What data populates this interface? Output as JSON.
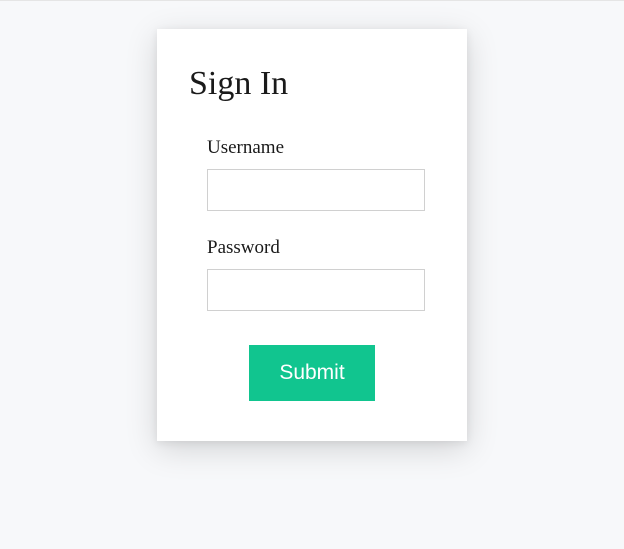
{
  "title": "Sign In",
  "form": {
    "username": {
      "label": "Username",
      "value": ""
    },
    "password": {
      "label": "Password",
      "value": ""
    },
    "submit_label": "Submit"
  },
  "colors": {
    "accent": "#11c58f",
    "background": "#f7f8fa",
    "card": "#ffffff"
  }
}
